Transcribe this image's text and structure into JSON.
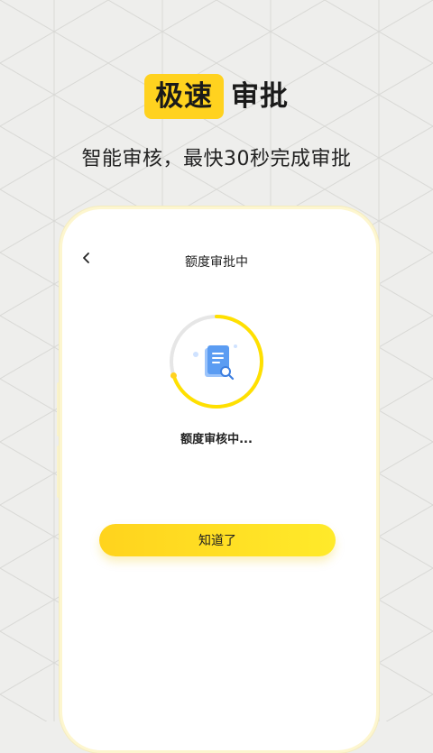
{
  "promo": {
    "badge": "极速",
    "headline_rest": "审批",
    "subtitle": "智能审核，最快30秒完成审批"
  },
  "screen": {
    "title": "额度审批中",
    "status_text": "额度审核中...",
    "progress_fraction": 0.7,
    "confirm_label": "知道了"
  },
  "colors": {
    "accent": "#ffd21f",
    "ring_track": "#e6e6e6",
    "doc_icon": "#5b9cf2",
    "background": "#eeeeec"
  },
  "icons": {
    "back": "chevron-left-icon",
    "document": "document-search-icon"
  }
}
